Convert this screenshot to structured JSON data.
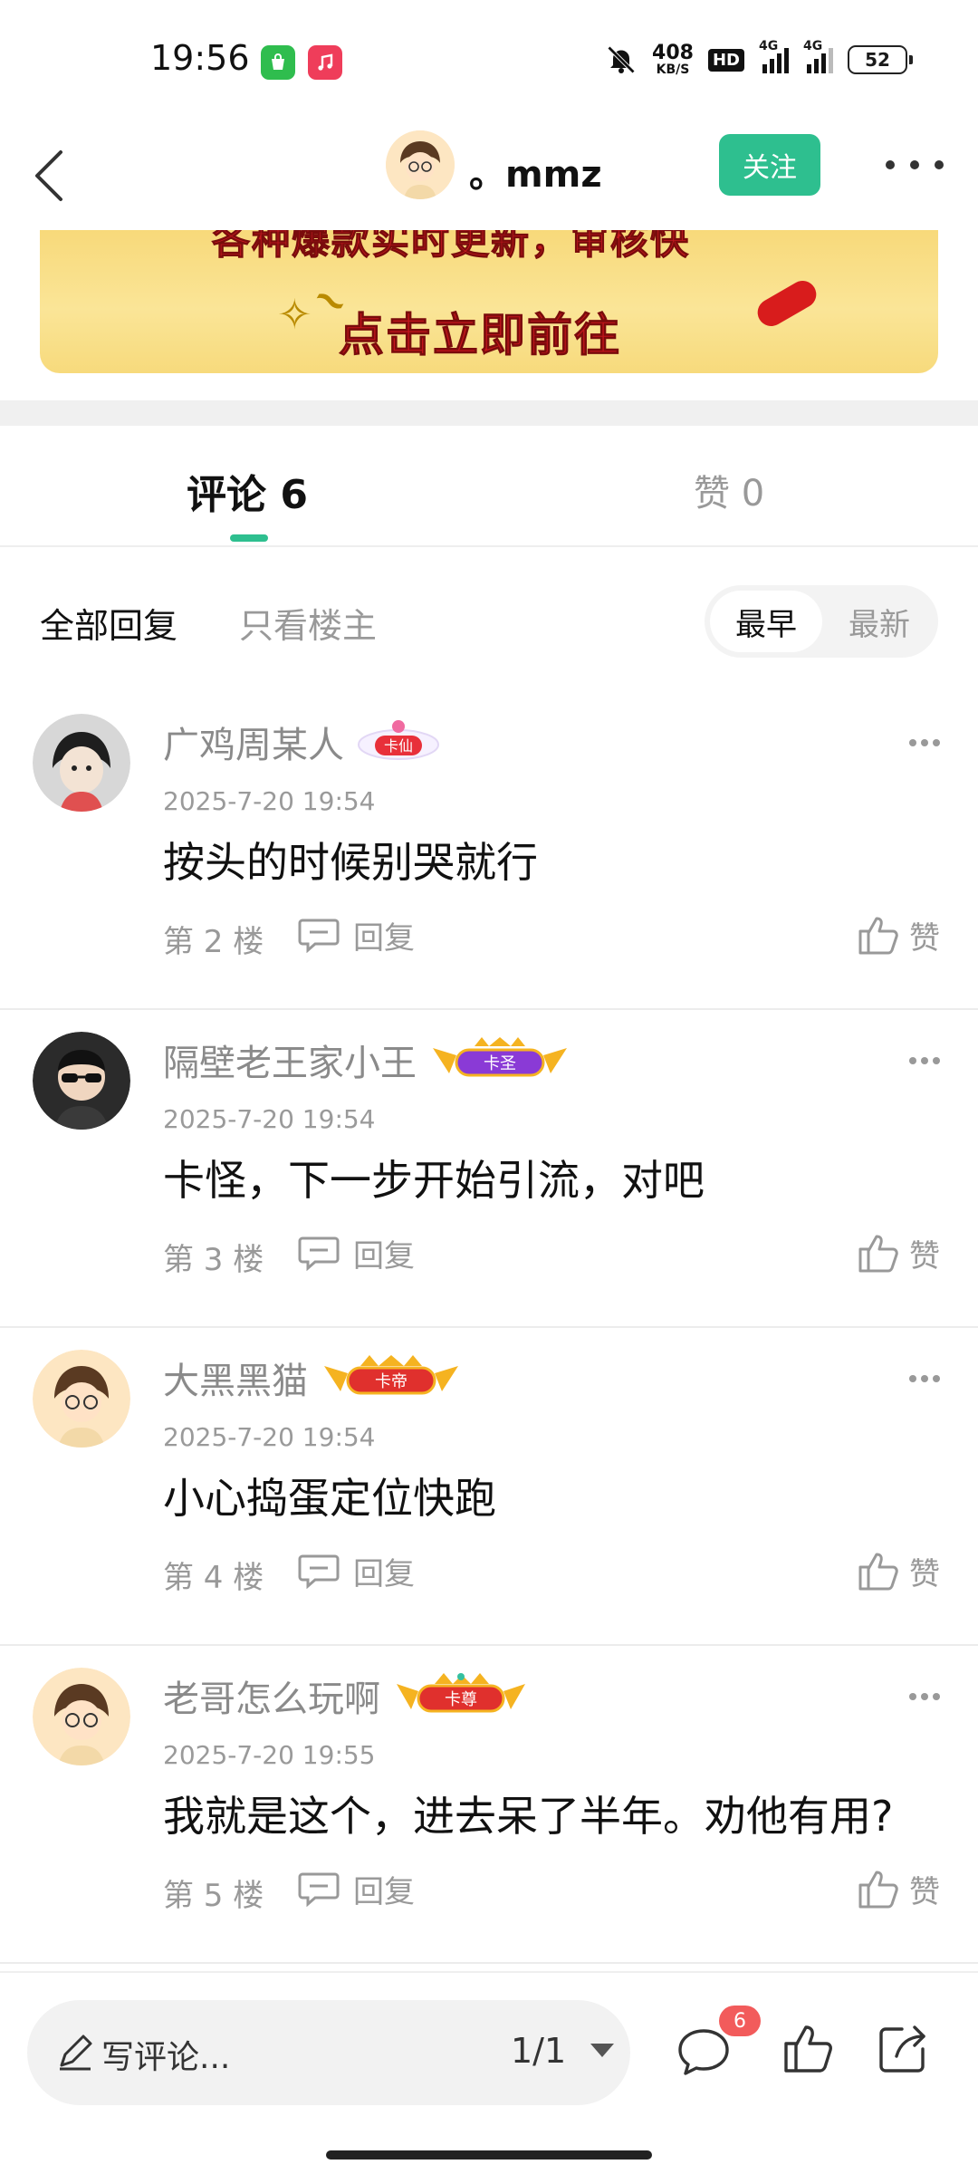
{
  "status_bar": {
    "time": "19:56",
    "net_speed_value": "408",
    "net_speed_unit": "KB/S",
    "hd_label": "HD",
    "signal_label_1": "4G",
    "signal_label_2": "4G",
    "battery_level": "52",
    "icons": [
      "store-app-icon",
      "music-app-icon",
      "mute-bell-icon",
      "hd-voice-icon",
      "signal-icon",
      "signal-icon",
      "battery-icon"
    ]
  },
  "nav": {
    "username": "。mmz",
    "follow_label": "关注"
  },
  "banner": {
    "top_text": "各种爆款实时更新，审核快",
    "main_text": "点击立即前往"
  },
  "tabs": {
    "comments_label": "评论 6",
    "likes_label": "赞 0"
  },
  "filters": {
    "all_label": "全部回复",
    "op_only_label": "只看楼主",
    "sort_earliest": "最早",
    "sort_latest": "最新"
  },
  "comments": [
    {
      "name": "广鸡周某人",
      "badge": "卡仙",
      "time": "2025-7-20 19:54",
      "text": "按头的时候别哭就行",
      "floor": "第 2 楼",
      "reply": "回复",
      "like": "赞"
    },
    {
      "name": "隔壁老王家小王",
      "badge": "卡圣",
      "time": "2025-7-20 19:54",
      "text": "卡怪，下一步开始引流，对吧",
      "floor": "第 3 楼",
      "reply": "回复",
      "like": "赞"
    },
    {
      "name": "大黑黑猫",
      "badge": "卡帝",
      "time": "2025-7-20 19:54",
      "text": "小心捣蛋定位快跑",
      "floor": "第 4 楼",
      "reply": "回复",
      "like": "赞"
    },
    {
      "name": "老哥怎么玩啊",
      "badge": "卡尊",
      "time": "2025-7-20 19:55",
      "text": "我就是这个，进去呆了半年。劝他有用?",
      "floor": "第 5 楼",
      "reply": "回复",
      "like": "赞"
    }
  ],
  "bottom": {
    "compose_placeholder": "写评论...",
    "page_indicator": "1/1",
    "comment_count": "6"
  },
  "colors": {
    "accent": "#2ebf8f",
    "badge_red": "#f25b5b",
    "banner_red": "#c4151c",
    "banner_yellow": "#fae597"
  }
}
